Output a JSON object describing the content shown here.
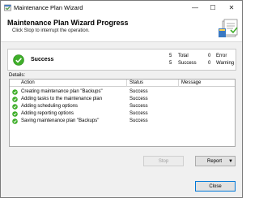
{
  "window": {
    "title": "Maintenance Plan Wizard",
    "min_glyph": "—",
    "max_glyph": "☐",
    "close_glyph": "✕"
  },
  "header": {
    "title": "Maintenance Plan Wizard Progress",
    "subtitle": "Click Stop to interrupt the operation."
  },
  "summary": {
    "status": "Success",
    "total_count": "5",
    "total_label": "Total",
    "success_count": "5",
    "success_label": "Success",
    "error_count": "0",
    "error_label": "Error",
    "warning_count": "0",
    "warning_label": "Warning"
  },
  "details": {
    "label": "Details:",
    "columns": [
      "Action",
      "Status",
      "Message"
    ],
    "rows": [
      {
        "action": "Creating maintenance plan \"Backups\"",
        "status": "Success",
        "message": ""
      },
      {
        "action": "Adding tasks to the maintenance plan",
        "status": "Success",
        "message": ""
      },
      {
        "action": "Adding scheduling options",
        "status": "Success",
        "message": ""
      },
      {
        "action": "Adding reporting options",
        "status": "Success",
        "message": ""
      },
      {
        "action": "Saving maintenance plan \"Backups\"",
        "status": "Success",
        "message": ""
      }
    ]
  },
  "buttons": {
    "stop": "Stop",
    "report": "Report",
    "close": "Close"
  },
  "colors": {
    "success_green": "#3fae2a",
    "close_border": "#0078d7"
  },
  "icons": {
    "app": "wizard-app-icon",
    "header": "maintenance-plan-icon",
    "success": "success-check-icon"
  }
}
